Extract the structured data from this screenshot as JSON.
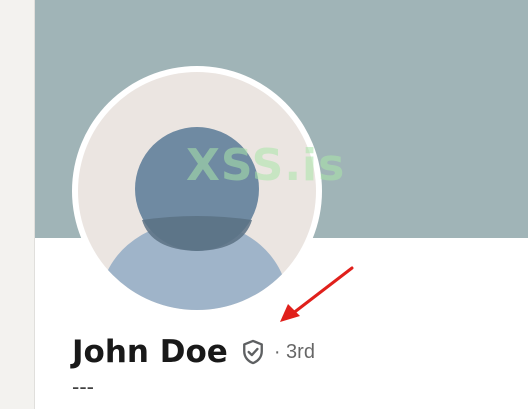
{
  "profile": {
    "name": "John Doe",
    "degree": "· 3rd",
    "headline": "---",
    "verified_icon": "shield-check-icon"
  },
  "watermark": {
    "text": "XSS.is"
  },
  "colors": {
    "banner": "#a0b4b7",
    "avatar_bg": "#ebe5e1",
    "avatar_head": "#6f8aa2",
    "avatar_body": "#9fb4c9",
    "arrow": "#e0201b",
    "watermark": "#aae6aa"
  },
  "annotation": {
    "arrow_icon": "red-arrow-icon"
  }
}
